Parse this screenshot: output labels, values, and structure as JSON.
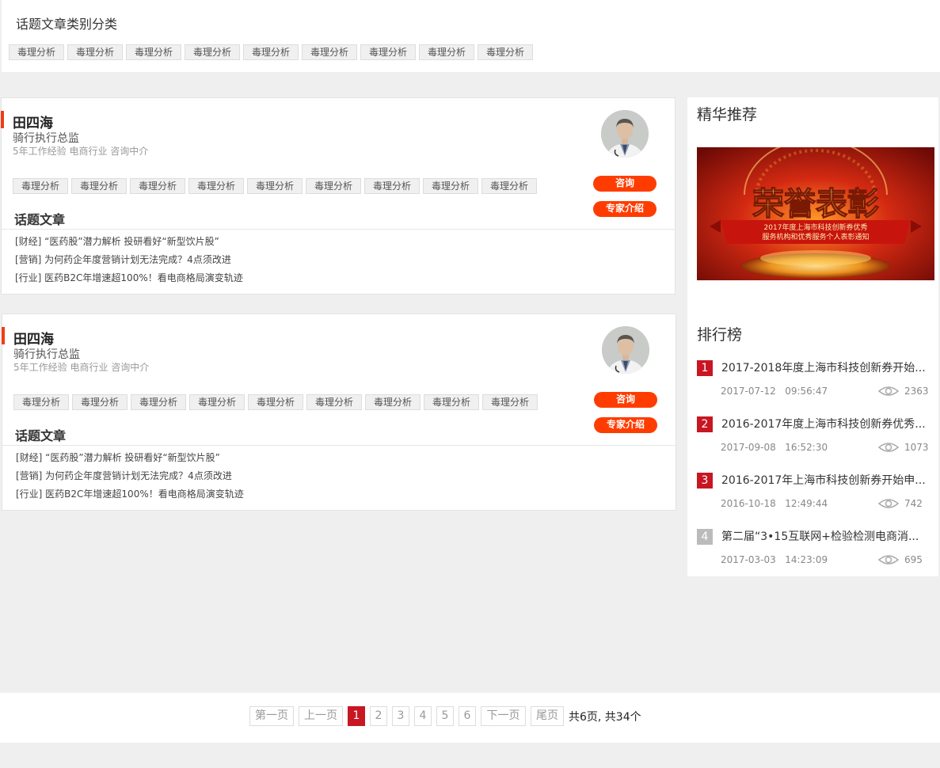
{
  "category_panel": {
    "title": "话题文章类别分类",
    "tags": [
      "毒理分析",
      "毒理分析",
      "毒理分析",
      "毒理分析",
      "毒理分析",
      "毒理分析",
      "毒理分析",
      "毒理分析",
      "毒理分析"
    ]
  },
  "experts": [
    {
      "name": "田四海",
      "position": "骑行执行总监",
      "meta": "5年工作经验 电商行业 咨询中介",
      "tags": [
        "毒理分析",
        "毒理分析",
        "毒理分析",
        "毒理分析",
        "毒理分析",
        "毒理分析",
        "毒理分析",
        "毒理分析",
        "毒理分析"
      ],
      "consult_label": "咨询",
      "intro_label": "专家介绍",
      "section_title": "话题文章",
      "articles": [
        "[财经] “医药股”潜力解析 投研看好“新型饮片股”",
        "[营销] 为何药企年度营销计划无法完成？4点须改进",
        "[行业] 医药B2C年增速超100%！看电商格局演变轨迹"
      ]
    },
    {
      "name": "田四海",
      "position": "骑行执行总监",
      "meta": "5年工作经验 电商行业 咨询中介",
      "tags": [
        "毒理分析",
        "毒理分析",
        "毒理分析",
        "毒理分析",
        "毒理分析",
        "毒理分析",
        "毒理分析",
        "毒理分析",
        "毒理分析"
      ],
      "consult_label": "咨询",
      "intro_label": "专家介绍",
      "section_title": "话题文章",
      "articles": [
        "[财经] “医药股”潜力解析 投研看好“新型饮片股”",
        "[营销] 为何药企年度营销计划无法完成？4点须改进",
        "[行业] 医药B2C年增速超100%！看电商格局演变轨迹"
      ]
    }
  ],
  "sidebar": {
    "featured_title": "精华推荐",
    "banner": {
      "headline": "荣誉表彰",
      "subtitle_line1": "2017年度上海市科技创新券优秀",
      "subtitle_line2": "服务机构和优秀服务个人表彰通知"
    },
    "ranking_title": "排行榜",
    "ranking": [
      {
        "rank": "1",
        "title": "2017-2018年度上海市科技创新券开始...",
        "date": "2017-07-12",
        "time": "09:56:47",
        "views": "2363"
      },
      {
        "rank": "2",
        "title": "2016-2017年度上海市科技创新券优秀...",
        "date": "2017-09-08",
        "time": "16:52:30",
        "views": "1073"
      },
      {
        "rank": "3",
        "title": "2016-2017年上海市科技创新券开始申...",
        "date": "2016-10-18",
        "time": "12:49:44",
        "views": "742"
      },
      {
        "rank": "4",
        "title": "第二届“3•15互联网+检验检测电商消...",
        "date": "2017-03-03",
        "time": "14:23:09",
        "views": "695"
      }
    ]
  },
  "pagination": {
    "first": "第一页",
    "prev": "上一页",
    "pages": [
      "1",
      "2",
      "3",
      "4",
      "5",
      "6"
    ],
    "current": "1",
    "next": "下一页",
    "last": "尾页",
    "summary": "共6页, 共34个"
  },
  "colors": {
    "accent_red": "#c81623",
    "button_orange": "#ff3c00",
    "card_accent": "#f03c14"
  }
}
